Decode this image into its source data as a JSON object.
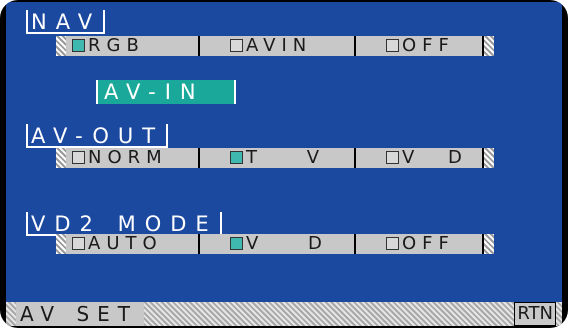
{
  "nav": {
    "title": "NAV",
    "options": [
      {
        "label": "RGB",
        "selected": true
      },
      {
        "label": "AVIN",
        "selected": false
      },
      {
        "label": "OFF",
        "selected": false
      }
    ]
  },
  "avin_banner": "AV-IN",
  "avout": {
    "title": "AV-OUT",
    "options": [
      {
        "label": "NORM",
        "selected": false
      },
      {
        "label": "T V",
        "selected": true
      },
      {
        "label": "V D",
        "selected": false
      }
    ]
  },
  "vd2": {
    "title": "VD2 MODE",
    "options": [
      {
        "label": "AUTO",
        "selected": false
      },
      {
        "label": "V D",
        "selected": true
      },
      {
        "label": "OFF",
        "selected": false
      }
    ]
  },
  "statusbar": {
    "title": "AV SET",
    "return_label": "RTN"
  },
  "colors": {
    "background": "#1b49a0",
    "selected": "#3fb8b0",
    "banner": "#1aa89a"
  }
}
